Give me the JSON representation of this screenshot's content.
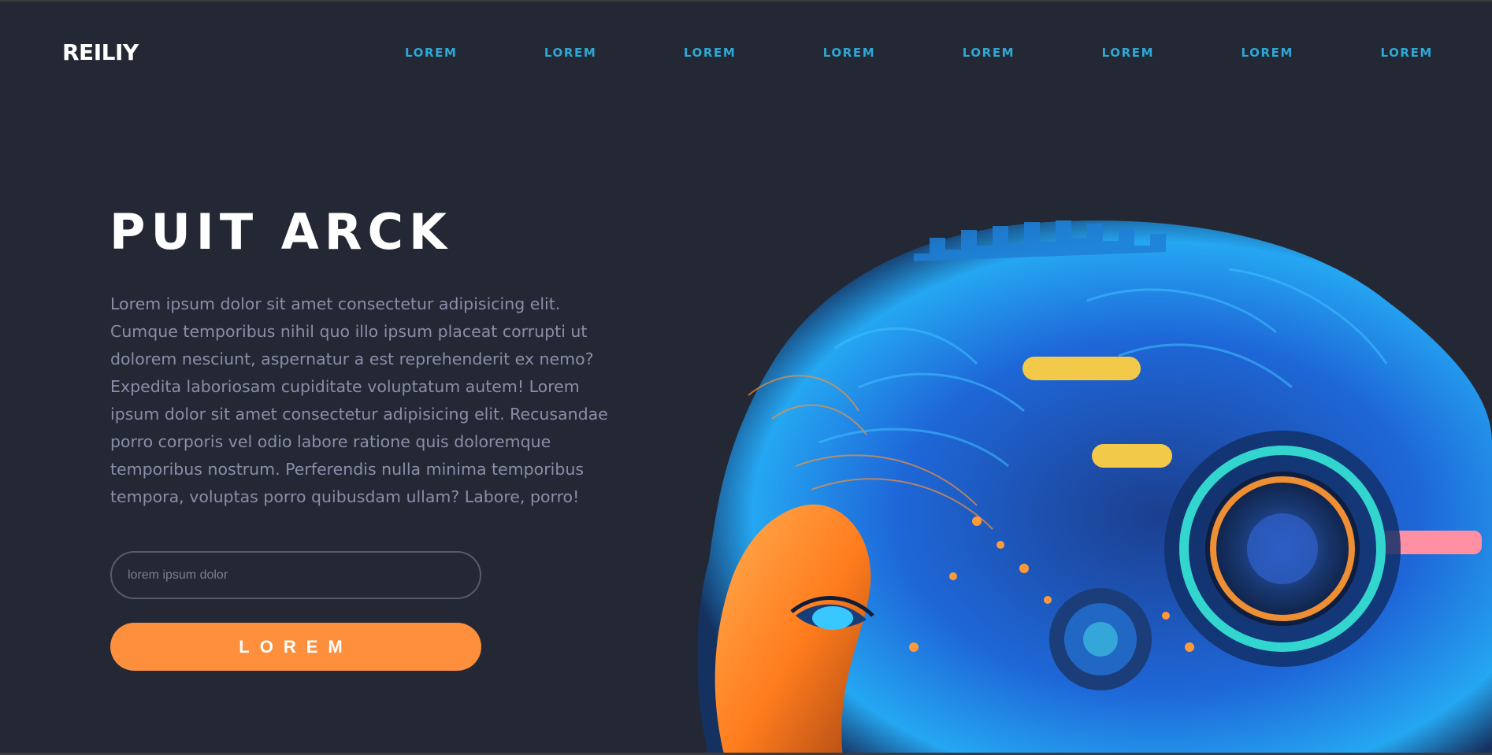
{
  "brand": {
    "logo": "REILIY"
  },
  "nav": {
    "items": [
      "LOREM",
      "LOREM",
      "LOREM",
      "LOREM",
      "LOREM",
      "LOREM",
      "LOREM",
      "LOREM"
    ]
  },
  "hero": {
    "title": "PUIT ARCK",
    "text": "Lorem ipsum dolor sit amet consectetur adipisicing elit. Cumque temporibus nihil quo illo ipsum placeat corrupti ut dolorem nesciunt, aspernatur a est reprehenderit ex nemo? Expedita laboriosam cupiditate voluptatum autem! Lorem ipsum dolor sit amet consectetur adipisicing elit. Recusandae porro corporis vel odio labore ratione quis doloremque temporibus nostrum. Perferendis nulla minima temporibus tempora, voluptas porro quibusdam ullam? Labore, porro!",
    "input_placeholder": "lorem ipsum dolor",
    "input_value": "",
    "button_label": "LOREM"
  },
  "colors": {
    "background": "#232834",
    "nav_link": "#2ea8d5",
    "accent": "#fe8f3c",
    "text_muted": "#8a8fa9"
  }
}
